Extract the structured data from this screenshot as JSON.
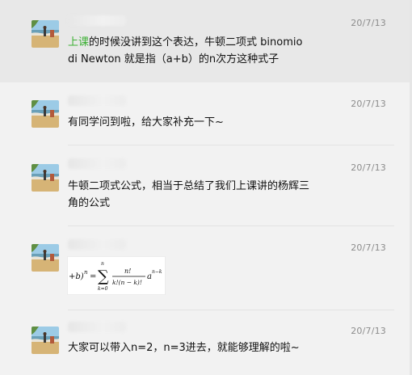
{
  "messages": [
    {
      "sender": "",
      "date": "20/7/13",
      "text_link": "上课",
      "text_rest_line1": "的时候没讲到这个表达，牛顿二项式 binomio",
      "text_line2": "di Newton 就是指（a+b）的n次方这种式子",
      "highlighted": true
    },
    {
      "sender": "",
      "date": "20/7/13",
      "text_line1": "有同学问到啦，给大家补充一下~"
    },
    {
      "sender": "",
      "date": "20/7/13",
      "text_line1": "牛顿二项式公式，相当于总结了我们上课讲的杨辉三",
      "text_line2": "角的公式"
    },
    {
      "sender": "",
      "date": "20/7/13",
      "formula": {
        "lhs": "+b)",
        "lhs_exp": "n",
        "eq": "=",
        "sum_top": "n",
        "sum_bottom": "k=0",
        "numerator": "n!",
        "denominator": "k!(n − k)!",
        "tail": "a",
        "tail_exp": "n−k"
      }
    },
    {
      "sender": "",
      "date": "20/7/13",
      "text_line1": "大家可以带入n=2，n=3进去，就能够理解的啦~"
    }
  ],
  "colors": {
    "background": "#f2f2f2",
    "highlight_background": "#e8e8e8",
    "link": "#3cb034",
    "date": "#8c8c8c",
    "text": "#111111"
  },
  "icons": {
    "avatar": "beach-photo-avatar"
  }
}
